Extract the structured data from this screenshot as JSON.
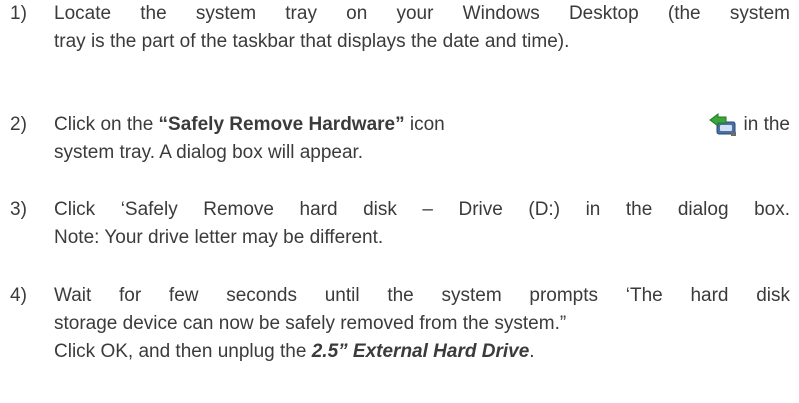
{
  "steps": [
    {
      "number": "1)",
      "line1": "Locate the system tray on your Windows Desktop (the system",
      "line2": "tray is the part of the taskbar that displays the date and time)."
    },
    {
      "number": "2)",
      "pre": "Click on the ",
      "bold": "“Safely Remove Hardware”",
      "mid": " icon",
      "icon": "safely-remove-hardware-icon",
      "post": "in the",
      "line2": "system tray. A dialog box will appear."
    },
    {
      "number": "3)",
      "line1": "Click ‘Safely Remove hard disk – Drive (D:) in the dialog box.",
      "line2": "Note: Your drive letter may be different."
    },
    {
      "number": "4)",
      "line1": "Wait for few seconds until the system prompts ‘The hard disk",
      "line2": "storage device can now be safely removed from the system.”",
      "line3_pre": "Click OK, and then unplug the ",
      "line3_bold": "2.5” External Hard Drive",
      "line3_post": "."
    }
  ],
  "colors": {
    "text": "#3b3b3b",
    "icon_green": "#3aa53a",
    "icon_device": "#4a6fa5"
  }
}
